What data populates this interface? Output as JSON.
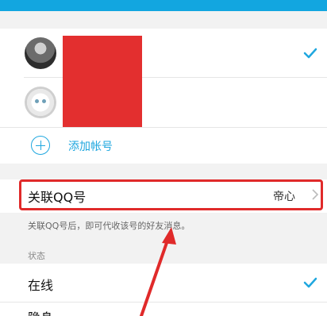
{
  "accounts": {
    "items": [
      {
        "selected": true,
        "avatar": "person-photo"
      },
      {
        "selected": false,
        "avatar": "white-cat-photo"
      }
    ],
    "add_label": "添加帐号"
  },
  "link_qq": {
    "label": "关联QQ号",
    "value": "帝心",
    "hint": "关联QQ号后，即可代收该号的好友消息。"
  },
  "status": {
    "header": "状态",
    "options": [
      {
        "label": "在线",
        "selected": true
      },
      {
        "label": "隐身",
        "selected": false
      }
    ]
  },
  "colors": {
    "accent": "#1fa7df",
    "highlight": "#e02a2a",
    "redaction": "#e32f2f"
  },
  "icons": {
    "check": "check-icon",
    "add": "add-circle-icon",
    "chevron": "chevron-right-icon",
    "annotation": "red-arrow-annotation"
  }
}
